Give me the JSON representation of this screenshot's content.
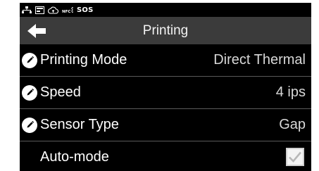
{
  "status_bar": {
    "icons": [
      "network-icon",
      "card-icon",
      "cloud-upload-icon",
      "nfc-icon"
    ],
    "sos_label": "SOS"
  },
  "header": {
    "back_icon": "arrow-left-icon",
    "title": "Printing"
  },
  "settings": [
    {
      "label": "Printing Mode",
      "value": "Direct Thermal",
      "icon": "pencil-icon"
    },
    {
      "label": "Speed",
      "value": "4 ips",
      "icon": "pencil-icon"
    },
    {
      "label": "Sensor Type",
      "value": "Gap",
      "icon": "pencil-icon"
    },
    {
      "label": "Auto-mode",
      "checked": true
    }
  ],
  "colors": {
    "background": "#000000",
    "title_bar": "#3b3b3b",
    "text": "#ffffff",
    "value_text": "#d8d8d8",
    "divider": "#5a5a5a"
  }
}
